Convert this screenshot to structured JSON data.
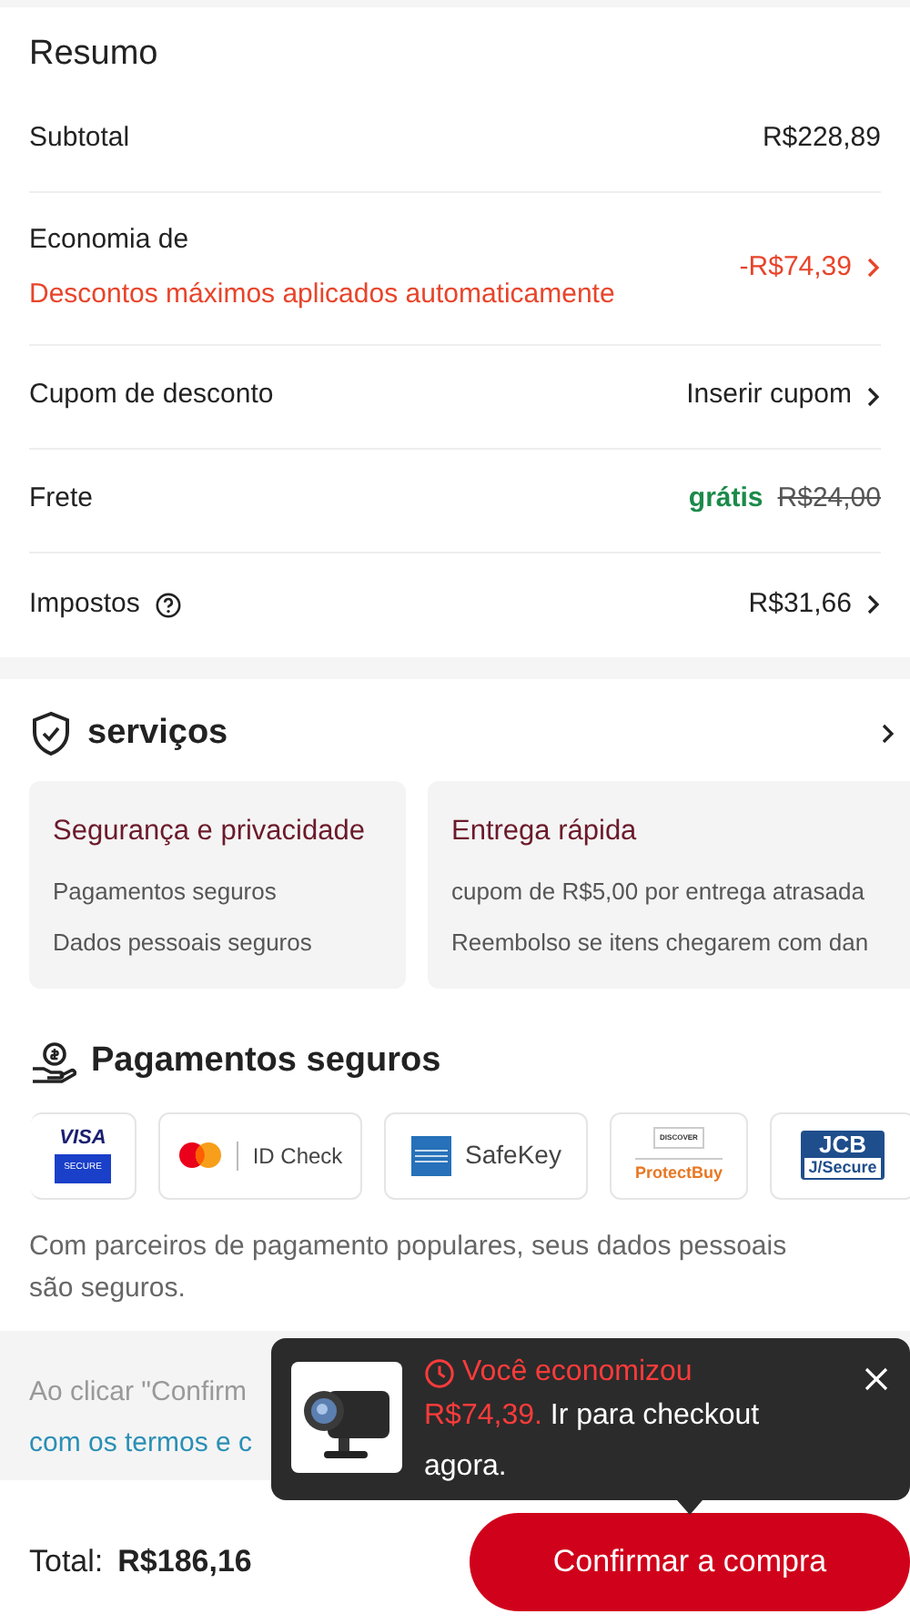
{
  "summary": {
    "title": "Resumo",
    "rows": [
      {
        "kind": "plain",
        "label": "Subtotal",
        "value": "R$228,89",
        "chevron": false
      },
      {
        "kind": "discount",
        "label": "Economia de",
        "note": "Descontos máximos aplicados automaticamente",
        "value": "-R$74,39",
        "chevron": true
      },
      {
        "kind": "plain",
        "label": "Cupom de desconto",
        "value": "Inserir cupom",
        "chevron": true
      },
      {
        "kind": "shipping",
        "label": "Frete",
        "free_label": "grátis",
        "old_value": "R$24,00",
        "chevron": false
      },
      {
        "kind": "tax",
        "label": "Impostos",
        "value": "R$31,66",
        "chevron": true
      }
    ]
  },
  "services": {
    "title": "serviços",
    "cards": [
      {
        "title": "Segurança e privacidade",
        "lines": [
          "Pagamentos seguros",
          "Dados pessoais seguros"
        ]
      },
      {
        "title": "Entrega rápida",
        "lines": [
          "cupom de R$5,00 por entrega atrasada",
          "Reembolso se itens chegarem com dan"
        ]
      }
    ]
  },
  "payments": {
    "title": "Pagamentos seguros",
    "logos": [
      {
        "kind": "visa",
        "texts": [
          "VISA",
          "SECURE"
        ]
      },
      {
        "kind": "mastercard",
        "texts": [
          "ID Check"
        ]
      },
      {
        "kind": "amex",
        "texts": [
          "SafeKey"
        ]
      },
      {
        "kind": "discover",
        "texts": [
          "DISCOVER",
          "ProtectBuy"
        ]
      },
      {
        "kind": "jcb",
        "texts": [
          "JCB",
          "J/Secure"
        ]
      }
    ],
    "note": "Com parceiros de pagamento populares, seus dados pessoais são seguros."
  },
  "disclaimer": {
    "line_1": "Ao clicar \"Confirm",
    "link": "com os termos e c"
  },
  "toast": {
    "title": "Você economizou",
    "amount": "R$74,39.",
    "message": "Ir para checkout agora."
  },
  "footer": {
    "total_label": "Total:",
    "total": "R$186,16",
    "button": "Confirmar a compra"
  }
}
